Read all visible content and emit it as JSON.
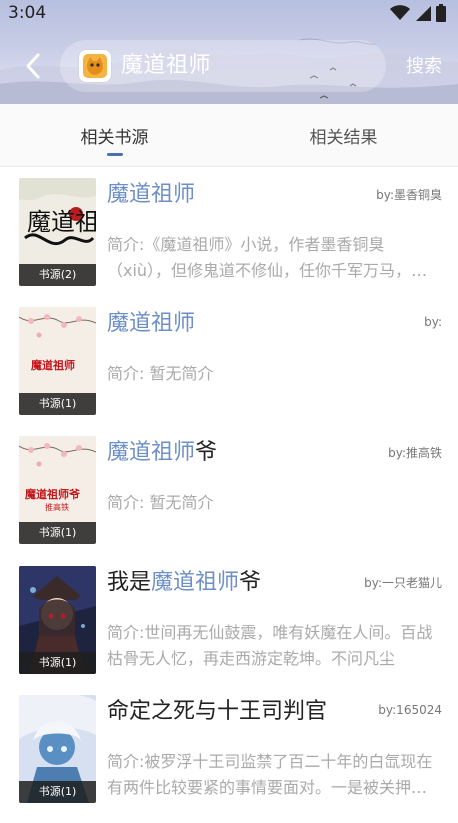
{
  "status_bar": {
    "time": "3:04"
  },
  "header": {
    "search_text": "魔道祖师",
    "search_button": "搜索"
  },
  "tabs": [
    {
      "label": "相关书源"
    },
    {
      "label": "相关结果"
    }
  ],
  "results": [
    {
      "title_hl": "魔道祖师",
      "title_rest": "",
      "author": "by:墨香铜臭",
      "desc": "简介:《魔道祖师》小说，作者墨香铜臭（xiù），但修鬼道不修仙，任你千军万马，十方恶霸，九州奇侠，高岭之花，但凡",
      "cover_label": "书源(2)"
    },
    {
      "title_hl": "魔道祖师",
      "title_rest": "",
      "author": "by:",
      "desc": "简介: 暂无简介",
      "cover_label": "书源(1)"
    },
    {
      "title_hl": "魔道祖师",
      "title_rest": "爷",
      "title_prefix": "",
      "author": "by:推高铁",
      "desc": "简介: 暂无简介",
      "cover_label": "书源(1)"
    },
    {
      "title_prefix": "我是",
      "title_hl": "魔道祖师",
      "title_rest": "爷",
      "author": "by:一只老猫儿",
      "desc": "简介:世间再无仙鼓震，唯有妖魔在人间。百战枯骨无人忆，再走西游定乾坤。不问凡尘",
      "cover_label": "书源(1)"
    },
    {
      "title_prefix": "命定之死与十王司判官",
      "title_hl": "",
      "title_rest": "",
      "author": "by:165024",
      "desc": "简介:被罗浮十王司监禁了百二十年的白氙现在有两件比较要紧的事情要面对。一是被关押了太",
      "cover_label": "书源(1)"
    }
  ],
  "covers": {
    "c1_text": "魔道祖师",
    "c2_text": "魔道祖师",
    "c3_text": "魔道祖师爷",
    "c3_sub": "推高铁"
  },
  "colors": {
    "accent": "#6d8fc9",
    "underline": "#4a6fb3"
  }
}
